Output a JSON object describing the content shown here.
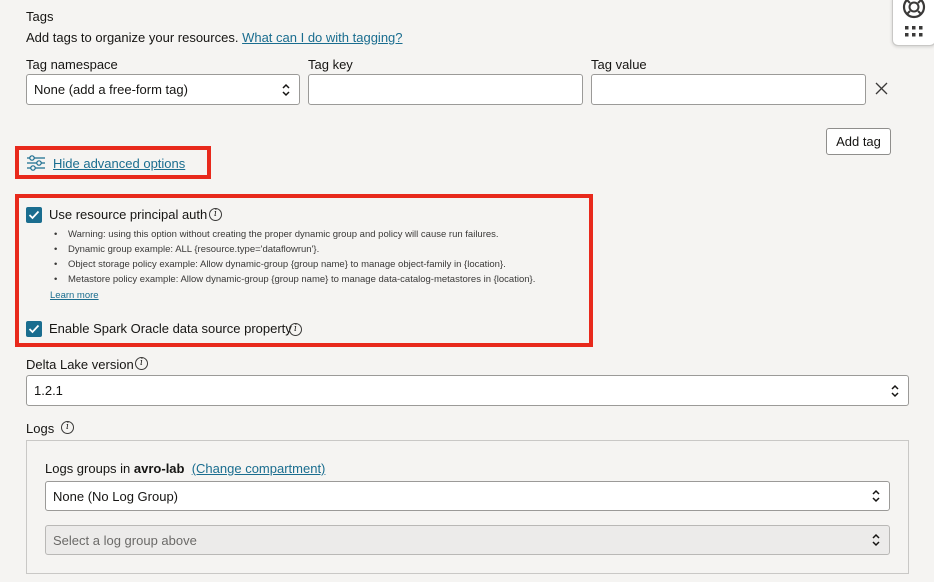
{
  "tags": {
    "heading": "Tags",
    "description": "Add tags to organize your resources.",
    "help_link": "What can I do with tagging?",
    "namespace_label": "Tag namespace",
    "namespace_value": "None (add a free-form tag)",
    "key_label": "Tag key",
    "key_value": "",
    "value_label": "Tag value",
    "value_value": "",
    "add_tag_label": "Add tag"
  },
  "advanced": {
    "toggle_label": "Hide advanced options"
  },
  "principal_auth": {
    "label": "Use resource principal auth",
    "checked": true,
    "bullets": [
      "Warning: using this option without creating the proper dynamic group and policy will cause run failures.",
      "Dynamic group example: ALL {resource.type='dataflowrun'}.",
      "Object storage policy example: Allow dynamic-group {group name} to manage object-family in {location}.",
      "Metastore policy example: Allow dynamic-group {group name} to manage data-catalog-metastores in {location}."
    ],
    "learn_more": "Learn more"
  },
  "spark_oracle": {
    "label": "Enable Spark Oracle data source property",
    "checked": true
  },
  "delta_lake": {
    "label": "Delta Lake version",
    "value": "1.2.1"
  },
  "logs": {
    "label": "Logs",
    "groups_prefix": "Logs groups in",
    "compartment": "avro-lab",
    "change_link": "(Change compartment)",
    "group_value": "None (No Log Group)",
    "log_placeholder": "Select a log group above"
  },
  "colors": {
    "accent": "#1a6d8f",
    "highlight": "#e8291c",
    "background": "#f5f4f2"
  },
  "icons": [
    "settings-sliders-icon",
    "info-icon",
    "close-icon",
    "checkmark-icon",
    "help-lifebuoy-icon",
    "apps-grid-icon",
    "updown-chevron-icon"
  ]
}
